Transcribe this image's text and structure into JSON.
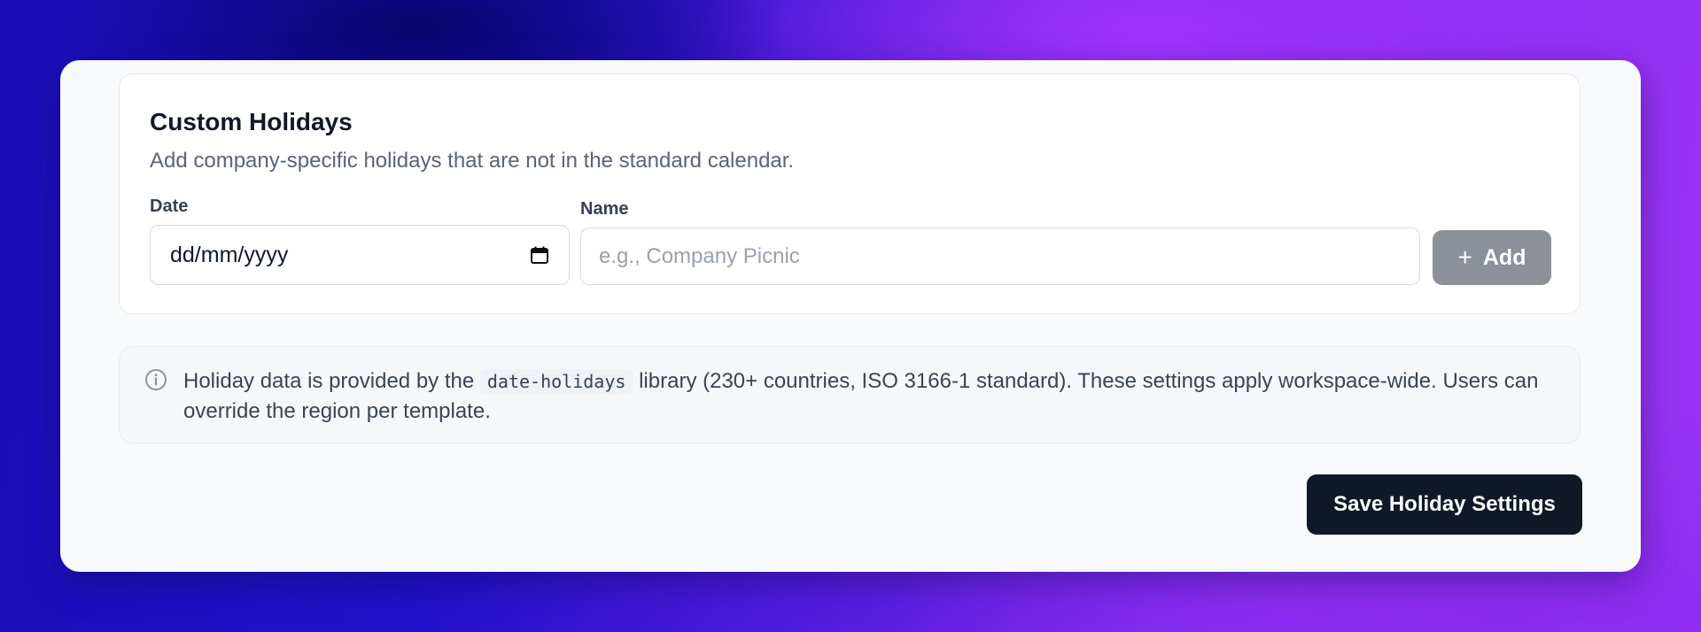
{
  "custom_holidays": {
    "title": "Custom Holidays",
    "description": "Add company-specific holidays that are not in the standard calendar.",
    "date_label": "Date",
    "date_value": "dd/mm/yyyy",
    "name_label": "Name",
    "name_placeholder": "e.g., Company Picnic",
    "add_button_label": "Add"
  },
  "info": {
    "text_before": "Holiday data is provided by the",
    "code": "date-holidays",
    "text_after": "library (230+ countries, ISO 3166-1 standard). These settings apply workspace-wide. Users can override the region per template."
  },
  "footer": {
    "save_button_label": "Save Holiday Settings"
  },
  "icons": {
    "date": "calendar-icon",
    "add": "plus-icon",
    "info": "info-circle-icon"
  },
  "colors": {
    "primary_button": "#111827",
    "disabled_button": "#8b9099"
  }
}
